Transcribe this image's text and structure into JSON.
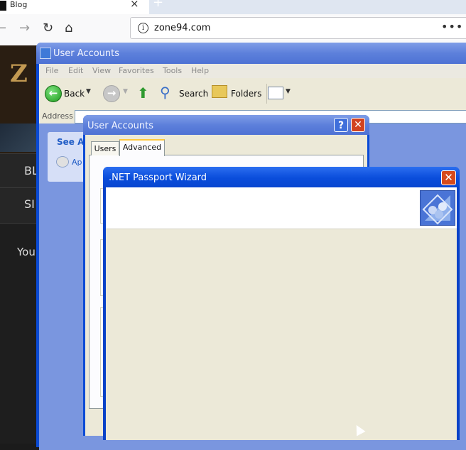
{
  "browser": {
    "tab_title": "Blog",
    "new_tab_icon": "+",
    "close_icon": "×",
    "url": "zone94.com",
    "menu_icon": "•••"
  },
  "site": {
    "logo": "Z",
    "nav_items": [
      "BL",
      "SI",
      "You"
    ]
  },
  "user_accounts_window": {
    "title": "User Accounts",
    "menu": [
      "File",
      "Edit",
      "View",
      "Favorites",
      "Tools",
      "Help"
    ],
    "toolbar": {
      "back": "Back",
      "search": "Search",
      "folders": "Folders"
    },
    "address_label": "Address",
    "tasks_title": "See Al",
    "tasks_link": "Ap"
  },
  "user_accounts_dialog": {
    "title": "User Accounts",
    "help_label": "?",
    "close_label": "✕",
    "tabs": [
      "Users",
      "Advanced"
    ],
    "active_tab": "Advanced"
  },
  "passport_wizard": {
    "title": ".NET Passport Wizard",
    "close_label": "✕"
  }
}
